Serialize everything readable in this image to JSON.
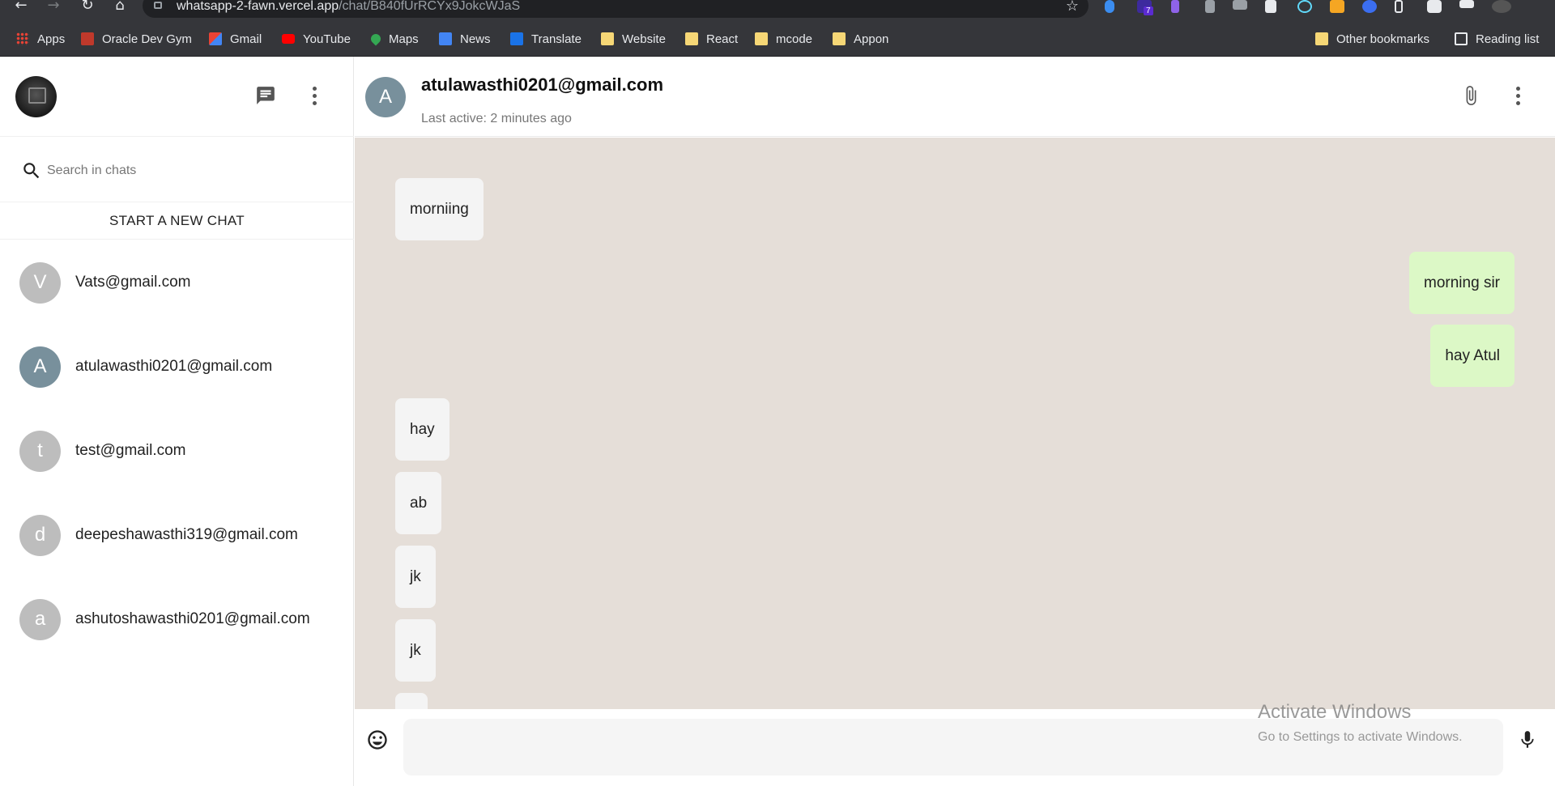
{
  "browser": {
    "url_host": "whatsapp-2-fawn.vercel.app",
    "url_path": "/chat/B840fUrRCYx9JokcWJaS",
    "extension_badge": "7",
    "bookmarks": [
      {
        "label": "Apps",
        "icon": "apps-grid-icon"
      },
      {
        "label": "Oracle Dev Gym",
        "icon": "oracle-icon"
      },
      {
        "label": "Gmail",
        "icon": "gmail-icon"
      },
      {
        "label": "YouTube",
        "icon": "youtube-icon"
      },
      {
        "label": "Maps",
        "icon": "maps-icon"
      },
      {
        "label": "News",
        "icon": "news-icon"
      },
      {
        "label": "Translate",
        "icon": "translate-icon"
      },
      {
        "label": "Website",
        "icon": "folder-icon"
      },
      {
        "label": "React",
        "icon": "folder-icon"
      },
      {
        "label": "mcode",
        "icon": "folder-icon"
      },
      {
        "label": "Appon",
        "icon": "folder-icon"
      }
    ],
    "other_bookmarks": "Other bookmarks",
    "reading_list": "Reading list"
  },
  "sidebar": {
    "search_placeholder": "Search in chats",
    "new_chat_label": "START A NEW CHAT",
    "chats": [
      {
        "initial": "V",
        "email": "Vats@gmail.com"
      },
      {
        "initial": "A",
        "email": "atulawasthi0201@gmail.com"
      },
      {
        "initial": "t",
        "email": "test@gmail.com"
      },
      {
        "initial": "d",
        "email": "deepeshawasthi319@gmail.com"
      },
      {
        "initial": "a",
        "email": "ashutoshawasthi0201@gmail.com"
      }
    ]
  },
  "chat": {
    "contact_initial": "A",
    "contact_name": "atulawasthi0201@gmail.com",
    "last_active": "Last active: 2 minutes ago",
    "messages": [
      {
        "text": "morniing",
        "direction": "incoming"
      },
      {
        "text": "morning sir",
        "direction": "outgoing"
      },
      {
        "text": "hay Atul",
        "direction": "outgoing"
      },
      {
        "text": "hay",
        "direction": "incoming"
      },
      {
        "text": "ab",
        "direction": "incoming"
      },
      {
        "text": "jk",
        "direction": "incoming"
      },
      {
        "text": "jk",
        "direction": "incoming"
      },
      {
        "text": "",
        "direction": "incoming"
      }
    ],
    "input_value": ""
  },
  "watermark": {
    "title": "Activate Windows",
    "subtitle": "Go to Settings to activate Windows."
  },
  "colors": {
    "chat_background": "#e5ded8",
    "outgoing_bubble": "#dcf8c6",
    "incoming_bubble": "#f4f4f4",
    "active_avatar": "#78909c",
    "default_avatar": "#bdbdbd"
  }
}
